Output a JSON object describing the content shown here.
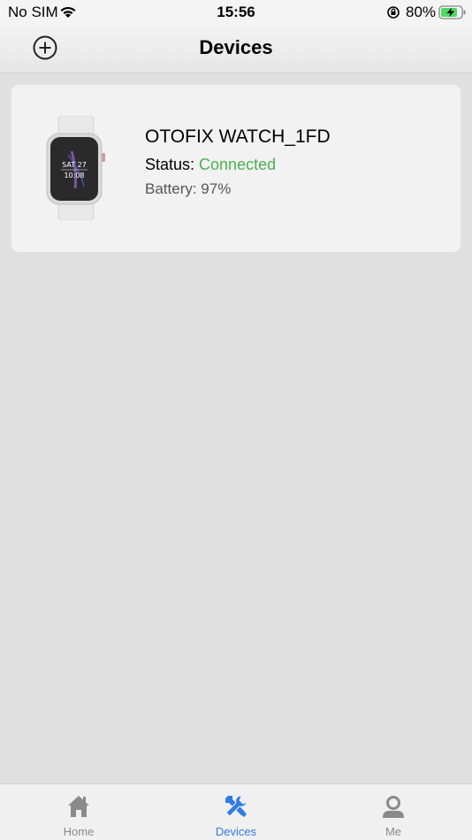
{
  "status_bar": {
    "carrier": "No SIM",
    "time": "15:56",
    "battery_pct": "80%"
  },
  "nav": {
    "title": "Devices"
  },
  "device": {
    "name": "OTOFIX WATCH_1FD",
    "status_label": "Status: ",
    "status_value": "Connected",
    "battery": "Battery: 97%",
    "watch_screen": {
      "day": "SAT 27",
      "time": "10:08"
    }
  },
  "tabs": [
    {
      "label": "Home",
      "icon": "home-icon",
      "active": false
    },
    {
      "label": "Devices",
      "icon": "tools-icon",
      "active": true
    },
    {
      "label": "Me",
      "icon": "user-icon",
      "active": false
    }
  ],
  "colors": {
    "accent": "#2f7be6",
    "connected": "#4caf50",
    "inactive": "#8a8a8a"
  }
}
